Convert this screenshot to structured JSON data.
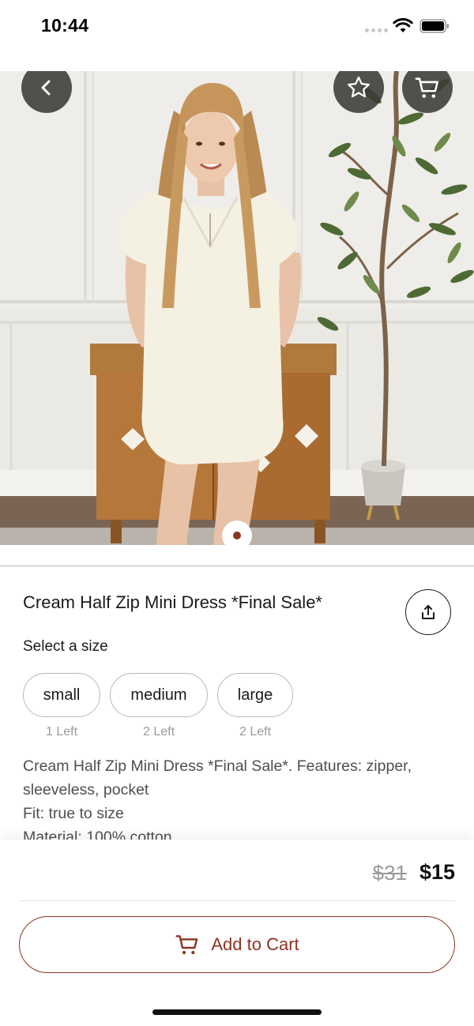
{
  "status_bar": {
    "time": "10:44",
    "icons": [
      "signal-dots-icon",
      "wifi-icon",
      "battery-icon"
    ]
  },
  "hero": {
    "image_description": "Model wearing a cream half zip mini dress standing in front of a wooden cabinet and a potted olive tree",
    "buttons": {
      "back_icon": "chevron-left-icon",
      "favorite_icon": "star-outline-icon",
      "cart_icon": "cart-icon"
    },
    "pager": {
      "count": 1,
      "active": 1
    }
  },
  "product": {
    "title": "Cream Half Zip Mini Dress *Final Sale*",
    "share_icon": "share-icon",
    "size_label": "Select a size",
    "sizes": [
      {
        "label": "small",
        "stock": "1 Left"
      },
      {
        "label": "medium",
        "stock": "2 Left"
      },
      {
        "label": "large",
        "stock": "2 Left"
      }
    ],
    "description_lines": [
      "Cream Half Zip Mini Dress *Final Sale*. Features: zipper, sleeveless, pocket",
      "Fit: true to size",
      "Material: 100% cotton"
    ]
  },
  "purchase": {
    "original_price": "$31",
    "sale_price": "$15",
    "add_to_cart_label": "Add to Cart",
    "add_to_cart_icon": "cart-icon"
  },
  "colors": {
    "accent": "#8f3322",
    "overlay_button": "#3a3a36",
    "muted_text": "#9a9a9a"
  }
}
